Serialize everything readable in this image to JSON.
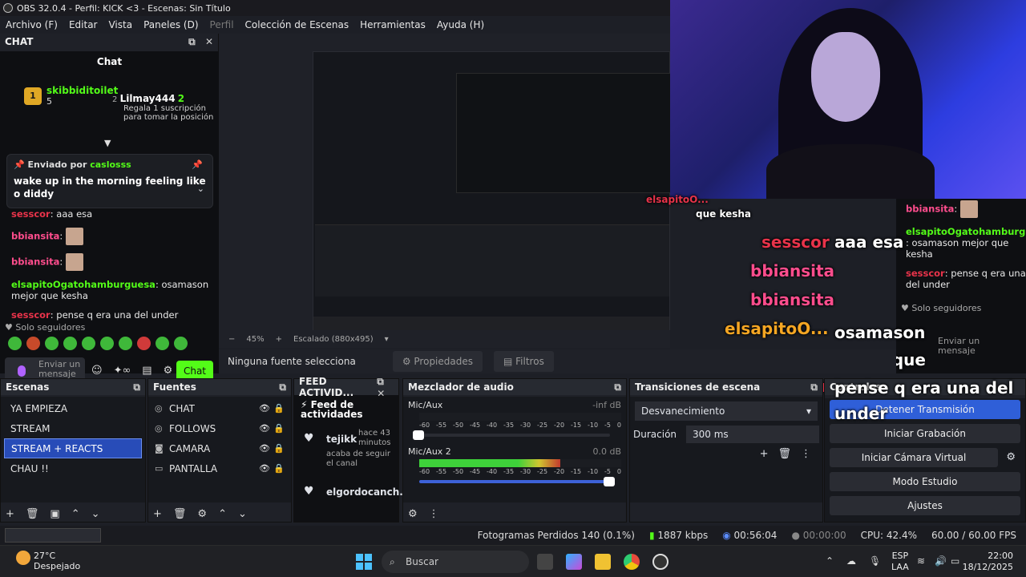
{
  "window": {
    "title": "OBS 32.0.4 - Perfil: KICK <3 - Escenas: Sin Título"
  },
  "menu": [
    "Archivo (F)",
    "Editar",
    "Vista",
    "Paneles (D)",
    "Perfil",
    "Colección de Escenas",
    "Herramientas",
    "Ayuda (H)"
  ],
  "chat_dock": {
    "title": "CHAT",
    "panel_title": "Chat",
    "leaders": [
      {
        "rank": "1",
        "name": "skibbiditoilet",
        "count": "5"
      },
      {
        "rank": "2",
        "name": "Lilmay444",
        "count": "2",
        "text": "Regala 1 suscripción para tomar la posición"
      }
    ],
    "pinned": {
      "prefix": "Enviado por",
      "user": "caslosss",
      "text": "wake up in the morning feeling like o diddy"
    },
    "messages": [
      {
        "user": "sesscor",
        "text": "aaa esa"
      },
      {
        "user": "bbiansita",
        "text": ""
      },
      {
        "user": "bbiansita",
        "text": ""
      },
      {
        "user": "elsapitoOgatohamburguesa",
        "text": "osamason mejor que kesha"
      },
      {
        "user": "sesscor",
        "text": "pense q era una del under"
      }
    ],
    "solo": "Solo seguidores",
    "input_placeholder": "Enviar un mensaje",
    "chat_button": "Chat"
  },
  "right_chat": {
    "messages": [
      {
        "user": "bbiansita",
        "text": ""
      },
      {
        "user": "elsapitoOgatohamburguesa",
        "text": ": osamason mejor que kesha"
      },
      {
        "user": "sesscor",
        "text": ": pense q era una del under"
      }
    ],
    "solo": "Solo seguidores",
    "input_placeholder": "Enviar un mensaje"
  },
  "overlay": {
    "lines": [
      {
        "user": "sesscor",
        "text": "aaa esa"
      },
      {
        "user": "bbiansita",
        "text": ""
      },
      {
        "user": "bbiansita",
        "text": ""
      },
      {
        "user": "elsapitoO...",
        "text": "osamason mejor que kesha"
      },
      {
        "user": "sesscor",
        "text": "pense q era una del under"
      }
    ],
    "small_name": "elsapitoO...",
    "small_text": "que kesha"
  },
  "preview": {
    "zoom": "45%",
    "scale": "Escalado (880x495)"
  },
  "source_bar": {
    "label": "Ninguna fuente selecciona",
    "props": "Propiedades",
    "filters": "Filtros"
  },
  "scenes": {
    "title": "Escenas",
    "items": [
      "YA EMPIEZA",
      "STREAM",
      "STREAM + REACTS",
      "CHAU !!"
    ],
    "selected": 2
  },
  "sources": {
    "title": "Fuentes",
    "items": [
      "CHAT",
      "FOLLOWS",
      "CAMARA",
      "PANTALLA"
    ]
  },
  "feed": {
    "title": "FEED ACTIVID...",
    "header": "Feed de actividades",
    "events": [
      {
        "user": "tejikk",
        "time": "hace 43 minutos",
        "text": "acaba de seguir el canal"
      },
      {
        "user": "elgordocanch...",
        "time": "",
        "text": ""
      }
    ]
  },
  "mixer": {
    "title": "Mezclador de audio",
    "channels": [
      {
        "name": "Mic/Aux",
        "db": "-inf dB",
        "level": 0.0,
        "volume": 0.0
      },
      {
        "name": "Mic/Aux 2",
        "db": "0.0 dB",
        "level": 0.7,
        "volume": 1.0
      }
    ],
    "ticks": [
      "-60",
      "-55",
      "-50",
      "-45",
      "-40",
      "-35",
      "-30",
      "-25",
      "-20",
      "-15",
      "-10",
      "-5",
      "0"
    ]
  },
  "transitions": {
    "title": "Transiciones de escena",
    "value": "Desvanecimiento",
    "duration_label": "Duración",
    "duration": "300 ms"
  },
  "controls": {
    "title": "Controles",
    "buttons": [
      "Detener Transmisión",
      "Iniciar Grabación",
      "Iniciar Cámara Virtual",
      "Modo Estudio",
      "Ajustes"
    ]
  },
  "status": {
    "dropped": "Fotogramas Perdidos 140 (0.1%)",
    "kbps": "1887 kbps",
    "stream_time": "00:56:04",
    "rec_time": "00:00:00",
    "cpu": "CPU: 42.4%",
    "fps": "60.00 / 60.00 FPS"
  },
  "taskbar": {
    "temp": "27°C",
    "weather": "Despejado",
    "search": "Buscar",
    "lang1": "ESP",
    "lang2": "LAA",
    "time": "22:00",
    "date": "18/12/2025"
  },
  "colors": {
    "kick_green": "#53fc18",
    "selected_blue": "#284cb8",
    "user_red": "#e8334a"
  }
}
